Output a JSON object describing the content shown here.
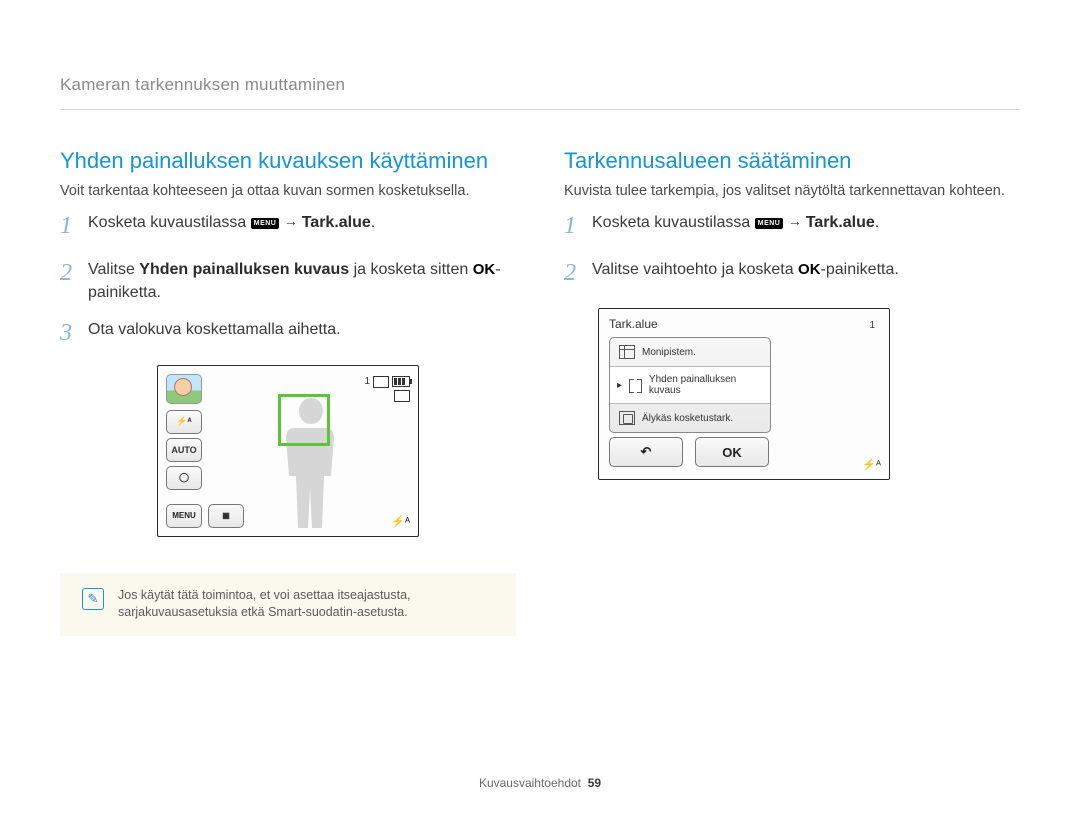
{
  "breadcrumb": "Kameran tarkennuksen muuttaminen",
  "left": {
    "heading": "Yhden painalluksen kuvauksen käyttäminen",
    "intro": "Voit tarkentaa kohteeseen ja ottaa kuvan sormen kosketuksella.",
    "steps": {
      "s1_a": "Kosketa kuvaustilassa ",
      "menu_label": "MENU",
      "s1_arrow": " → ",
      "s1_bold": "Tark.alue",
      "s1_end": ".",
      "s2_a": "Valitse ",
      "s2_bold": "Yhden painalluksen kuvaus",
      "s2_b": " ja kosketa sitten ",
      "s2_ok": "OK",
      "s2_c": "-painiketta.",
      "s3": "Ota valokuva koskettamalla aihetta."
    },
    "cam": {
      "side_flash": "⚡ᴬ",
      "side_auto": "AUTO",
      "side_timer": "◯",
      "menu_btn": "MENU",
      "gallery_btn": "▦",
      "count": "1",
      "fa": "⚡ᴬ"
    },
    "note": "Jos käytät tätä toimintoa, et voi asettaa itseajastusta, sarjakuvausasetuksia etkä Smart-suodatin-asetusta."
  },
  "right": {
    "heading": "Tarkennusalueen säätäminen",
    "intro": "Kuvista tulee tarkempia, jos valitset näytöltä tarkennettavan kohteen.",
    "steps": {
      "s1_a": "Kosketa kuvaustilassa ",
      "menu_label": "MENU",
      "s1_arrow": " → ",
      "s1_bold": "Tark.alue",
      "s1_end": ".",
      "s2_a": "Valitse vaihtoehto ja kosketa ",
      "s2_ok": "OK",
      "s2_b": "-painiketta."
    },
    "cam": {
      "title": "Tark.alue",
      "opt1": "Monipistem.",
      "opt2": "Yhden painalluksen kuvaus",
      "opt3": "Älykäs kosketustark.",
      "back": "↶",
      "ok": "OK",
      "count": "1",
      "fa": "⚡ᴬ"
    }
  },
  "footer": {
    "label": "Kuvausvaihtoehdot",
    "page": "59"
  }
}
